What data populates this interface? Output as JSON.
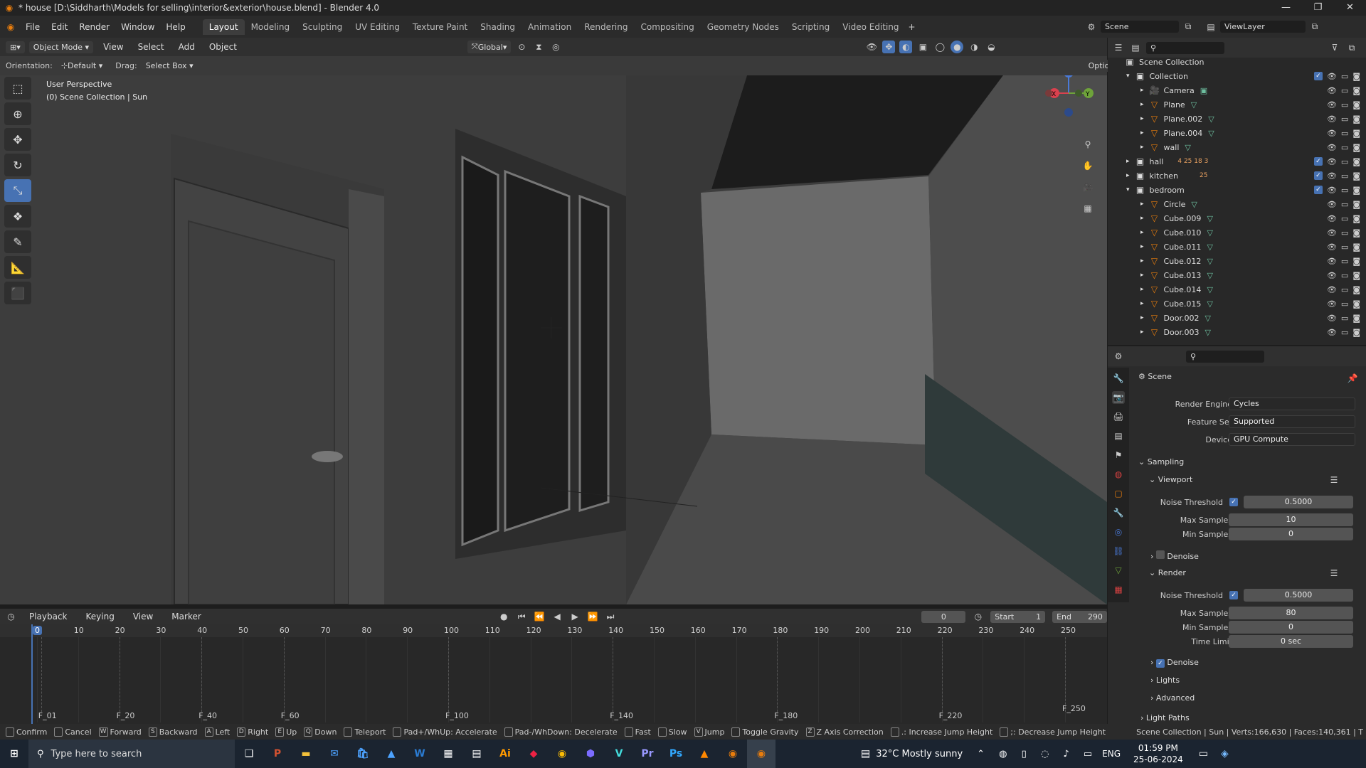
{
  "title_bar": {
    "text": "* house [D:\\Siddharth\\Models for selling\\interior&exterior\\house.blend] - Blender 4.0"
  },
  "menu": [
    "File",
    "Edit",
    "Render",
    "Window",
    "Help"
  ],
  "workspaces": [
    "Layout",
    "Modeling",
    "Sculpting",
    "UV Editing",
    "Texture Paint",
    "Shading",
    "Animation",
    "Rendering",
    "Compositing",
    "Geometry Nodes",
    "Scripting",
    "Video Editing"
  ],
  "active_workspace": "Layout",
  "scene_name": "Scene",
  "view_layer": "ViewLayer",
  "header": {
    "mode": "Object Mode",
    "menus": [
      "View",
      "Select",
      "Add",
      "Object"
    ],
    "transform": "Global",
    "orientation_label": "Orientation:",
    "orientation_value": "Default",
    "drag_label": "Drag:",
    "drag_value": "Select Box",
    "options": "Options"
  },
  "viewport": {
    "line1": "User Perspective",
    "line2": "(0) Scene Collection | Sun"
  },
  "outliner": {
    "root": "Scene Collection",
    "rows": [
      {
        "name": "Collection",
        "type": "collection",
        "depth": 0,
        "open": true
      },
      {
        "name": "Camera",
        "type": "camera",
        "depth": 1
      },
      {
        "name": "Plane",
        "type": "mesh",
        "depth": 1
      },
      {
        "name": "Plane.002",
        "type": "mesh",
        "depth": 1
      },
      {
        "name": "Plane.004",
        "type": "mesh",
        "depth": 1
      },
      {
        "name": "wall",
        "type": "mesh",
        "depth": 1
      },
      {
        "name": "hall",
        "type": "collection",
        "depth": 0
      },
      {
        "name": "kitchen",
        "type": "collection",
        "depth": 0
      },
      {
        "name": "bedroom",
        "type": "collection",
        "depth": 0,
        "open": true
      },
      {
        "name": "Circle",
        "type": "mesh",
        "depth": 1
      },
      {
        "name": "Cube.009",
        "type": "mesh",
        "depth": 1
      },
      {
        "name": "Cube.010",
        "type": "mesh",
        "depth": 1
      },
      {
        "name": "Cube.011",
        "type": "mesh",
        "depth": 1
      },
      {
        "name": "Cube.012",
        "type": "mesh",
        "depth": 1
      },
      {
        "name": "Cube.013",
        "type": "mesh",
        "depth": 1
      },
      {
        "name": "Cube.014",
        "type": "mesh",
        "depth": 1
      },
      {
        "name": "Cube.015",
        "type": "mesh",
        "depth": 1
      },
      {
        "name": "Door.002",
        "type": "mesh",
        "depth": 1
      },
      {
        "name": "Door.003",
        "type": "mesh",
        "depth": 1
      }
    ],
    "hall_badges": "4 25 18 3",
    "kitchen_badges": "25"
  },
  "properties": {
    "context": "Scene",
    "render_engine_label": "Render Engine",
    "render_engine": "Cycles",
    "feature_set_label": "Feature Set",
    "feature_set": "Supported",
    "device_label": "Device",
    "device": "GPU Compute",
    "sampling": "Sampling",
    "viewport": "Viewport",
    "noise_threshold_label": "Noise Threshold",
    "vp_noise": "0.5000",
    "max_samples_label": "Max Samples",
    "vp_max": "10",
    "min_samples_label": "Min Samples",
    "vp_min": "0",
    "denoise": "Denoise",
    "render": "Render",
    "r_noise": "0.5000",
    "r_max": "80",
    "r_min": "0",
    "time_limit_label": "Time Limit",
    "time_limit": "0 sec",
    "lights": "Lights",
    "advanced": "Advanced",
    "light_paths": "Light Paths"
  },
  "timeline": {
    "menus": [
      "Playback",
      "Keying",
      "View",
      "Marker"
    ],
    "current_frame": "0",
    "start_label": "Start",
    "start": "1",
    "end_label": "End",
    "end": "290",
    "ticks": [
      "0",
      "10",
      "20",
      "30",
      "40",
      "50",
      "60",
      "70",
      "80",
      "90",
      "100",
      "110",
      "120",
      "130",
      "140",
      "150",
      "160",
      "170",
      "180",
      "190",
      "200",
      "210",
      "220",
      "230",
      "240",
      "250"
    ],
    "markers": [
      "F_01",
      "F_20",
      "F_40",
      "F_60",
      "F_100",
      "F_140",
      "F_180",
      "F_220",
      "F_250"
    ]
  },
  "status_bar": {
    "hints": [
      "Confirm",
      "Cancel",
      "Forward",
      "Backward",
      "Left",
      "Right",
      "Up",
      "Down",
      "Teleport",
      "Pad+/WhUp: Accelerate",
      "Pad-/WhDown: Decelerate",
      "Fast",
      "Slow",
      "Jump",
      "Toggle Gravity",
      "Z Axis Correction",
      ".: Increase Jump Height",
      ";: Decrease Jump Height"
    ],
    "hint_keys": [
      "",
      "",
      "W",
      "S",
      "A",
      "D",
      "E",
      "Q",
      "",
      "",
      "",
      "",
      "",
      "V",
      "",
      "Z",
      "",
      ""
    ],
    "stats": "Scene Collection | Sun | Verts:166,630 | Faces:140,361 | T"
  },
  "taskbar": {
    "search_placeholder": "Type here to search",
    "weather": "32°C  Mostly sunny",
    "lang": "ENG",
    "time": "01:59 PM",
    "date": "25-06-2024"
  }
}
